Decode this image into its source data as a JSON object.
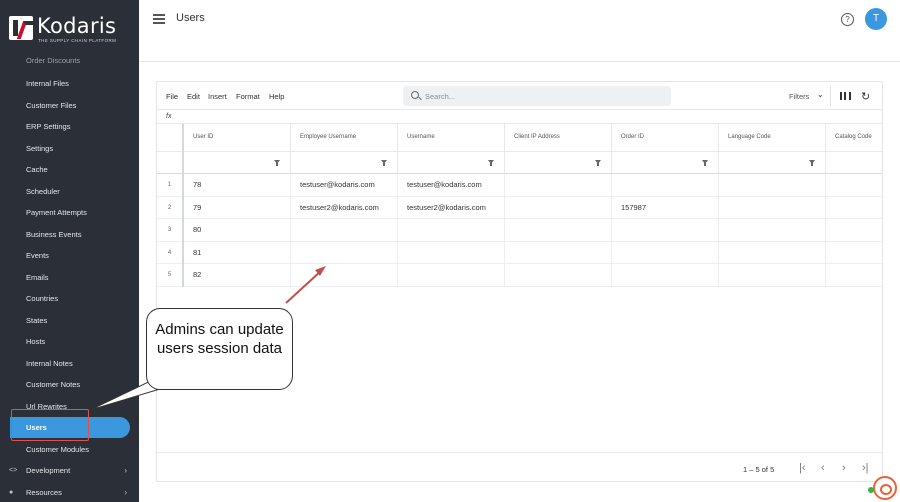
{
  "brand": {
    "name": "Kodaris",
    "tagline": "THE SUPPLY CHAIN PLATFORM"
  },
  "sidebar": {
    "items": [
      {
        "label": "Order Discounts"
      },
      {
        "label": "Internal Files"
      },
      {
        "label": "Customer Files"
      },
      {
        "label": "ERP Settings"
      },
      {
        "label": "Settings"
      },
      {
        "label": "Cache"
      },
      {
        "label": "Scheduler"
      },
      {
        "label": "Payment Attempts"
      },
      {
        "label": "Business Events"
      },
      {
        "label": "Events"
      },
      {
        "label": "Emails"
      },
      {
        "label": "Countries"
      },
      {
        "label": "States"
      },
      {
        "label": "Hosts"
      },
      {
        "label": "Internal Notes"
      },
      {
        "label": "Customer Notes"
      },
      {
        "label": "Url Rewrites"
      },
      {
        "label": "Users",
        "active": true
      },
      {
        "label": "Customer Modules"
      }
    ],
    "groups": [
      {
        "label": "Development",
        "icon": "code-icon"
      },
      {
        "label": "Resources",
        "icon": "help-circle-icon"
      }
    ]
  },
  "header": {
    "title": "Users",
    "avatar_initial": "T"
  },
  "toolbar": {
    "menus": [
      "File",
      "Edit",
      "Insert",
      "Format",
      "Help"
    ],
    "search_placeholder": "Search...",
    "filters_label": "Filters"
  },
  "grid": {
    "formula_label": "fx",
    "columns": [
      "User ID",
      "Employee Username",
      "Username",
      "Client IP Address",
      "Order ID",
      "Language Code",
      "Catalog Code"
    ],
    "rows": [
      {
        "num": "1",
        "cells": [
          "78",
          "testuser@kodaris.com",
          "testuser@kodaris.com",
          "",
          "",
          "",
          ""
        ]
      },
      {
        "num": "2",
        "cells": [
          "79",
          "testuser2@kodaris.com",
          "testuser2@kodaris.com",
          "",
          "157987",
          "",
          ""
        ]
      },
      {
        "num": "3",
        "cells": [
          "80",
          "",
          "",
          "",
          "",
          "",
          ""
        ]
      },
      {
        "num": "4",
        "cells": [
          "81",
          "",
          "",
          "",
          "",
          "",
          ""
        ]
      },
      {
        "num": "5",
        "cells": [
          "82",
          "",
          "",
          "",
          "",
          "",
          ""
        ]
      }
    ],
    "pager_range": "1 – 5 of 5"
  },
  "callout": {
    "text": "Admins can update users session data"
  },
  "colors": {
    "sidebar_bg": "#2b3038",
    "accent": "#3b98de",
    "annotation_red": "#d9534f",
    "brand_red": "#c8102e"
  }
}
